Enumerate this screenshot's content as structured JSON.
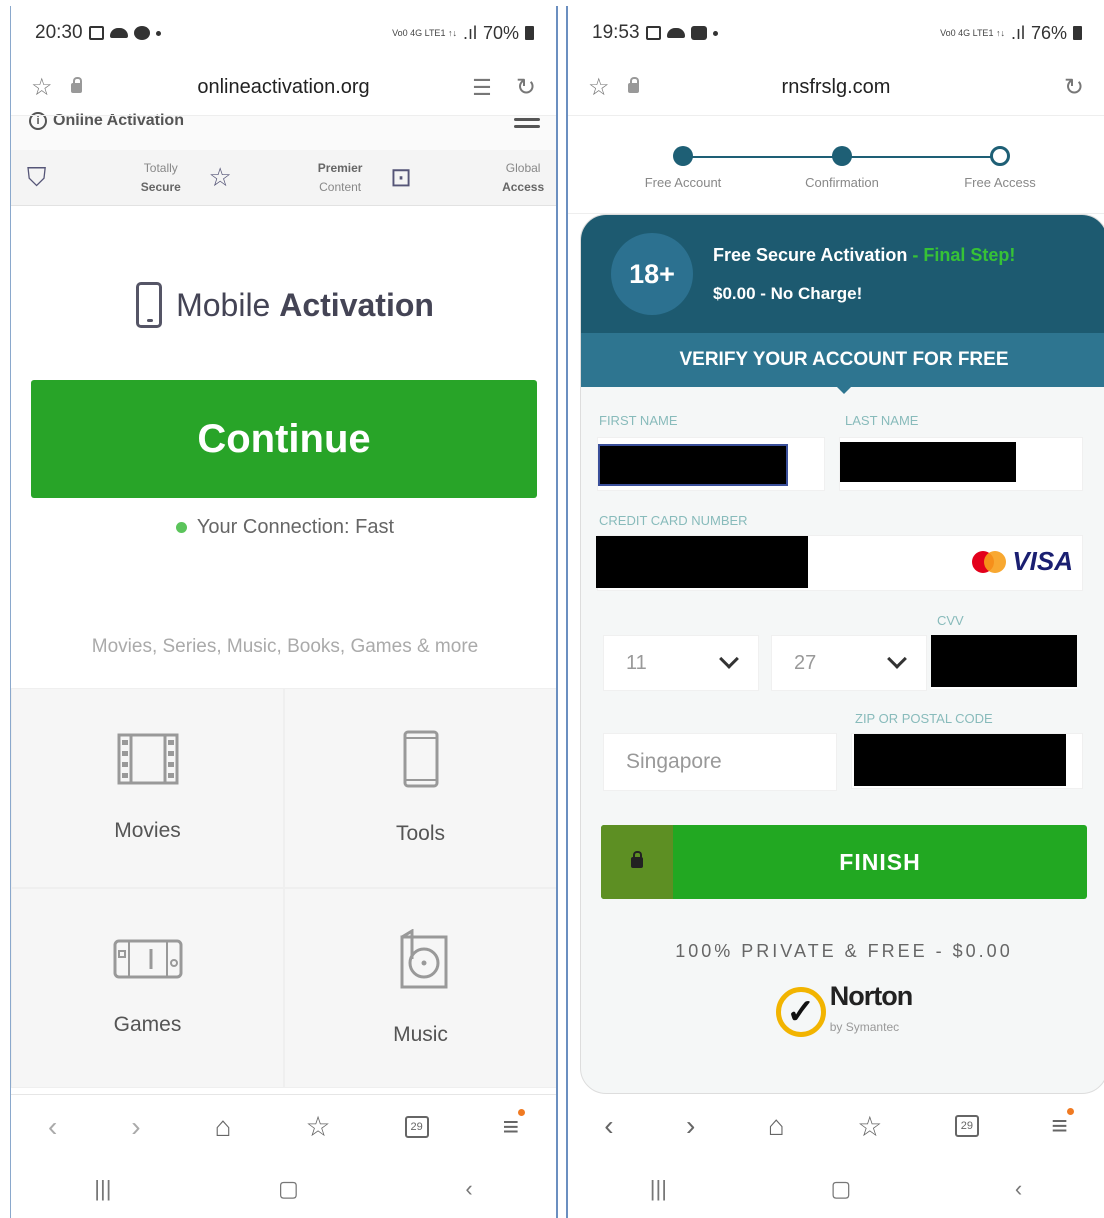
{
  "left": {
    "status": {
      "time": "20:30",
      "net": "Vo0 4G LTE1 ↑↓",
      "battery": "70%"
    },
    "url": "onlineactivation.org",
    "brand": "Online Activation",
    "features": [
      {
        "icon": "shield-icon",
        "line1": "Totally",
        "line2": "Secure"
      },
      {
        "icon": "star-icon",
        "line1": "Premier",
        "line2": "Content"
      },
      {
        "icon": "devices-icon",
        "line1": "Global",
        "line2": "Access"
      }
    ],
    "title_plain": "Mobile ",
    "title_bold": "Activation",
    "continue_label": "Continue",
    "connection": "Your Connection: Fast",
    "categories_text": "Movies, Series, Music, Books, Games & more",
    "tiles": [
      {
        "icon": "film-icon",
        "label": "Movies"
      },
      {
        "icon": "tablet-icon",
        "label": "Tools"
      },
      {
        "icon": "gamepad-icon",
        "label": "Games"
      },
      {
        "icon": "music-disc-icon",
        "label": "Music"
      }
    ],
    "tabs_count": "29"
  },
  "right": {
    "status": {
      "time": "19:53",
      "net": "Vo0 4G LTE1 ↑↓",
      "battery": "76%"
    },
    "url": "rnsfrslg.com",
    "steps": [
      "Free Account",
      "Confirmation",
      "Free Access"
    ],
    "badge": "18+",
    "promo_line1": "Free Secure Activation",
    "promo_final": " - Final Step!",
    "promo_line2": "$0.00 - No Charge!",
    "verify_title": "VERIFY YOUR ACCOUNT FOR FREE",
    "labels": {
      "first_name": "FIRST NAME",
      "last_name": "LAST NAME",
      "card_number": "CREDIT CARD NUMBER",
      "cvv": "CVV",
      "zip": "ZIP OR POSTAL CODE"
    },
    "card_brand": "VISA",
    "exp_month": "11",
    "exp_year": "27",
    "country": "Singapore",
    "finish_label": "FINISH",
    "private_text": "100% PRIVATE & FREE - $0.00",
    "norton_name": "Norton",
    "norton_sub": "by Symantec",
    "tabs_count": "29",
    "colors": {
      "teal_dark": "#1d5a70",
      "teal": "#2e7590",
      "green": "#22a822"
    }
  }
}
